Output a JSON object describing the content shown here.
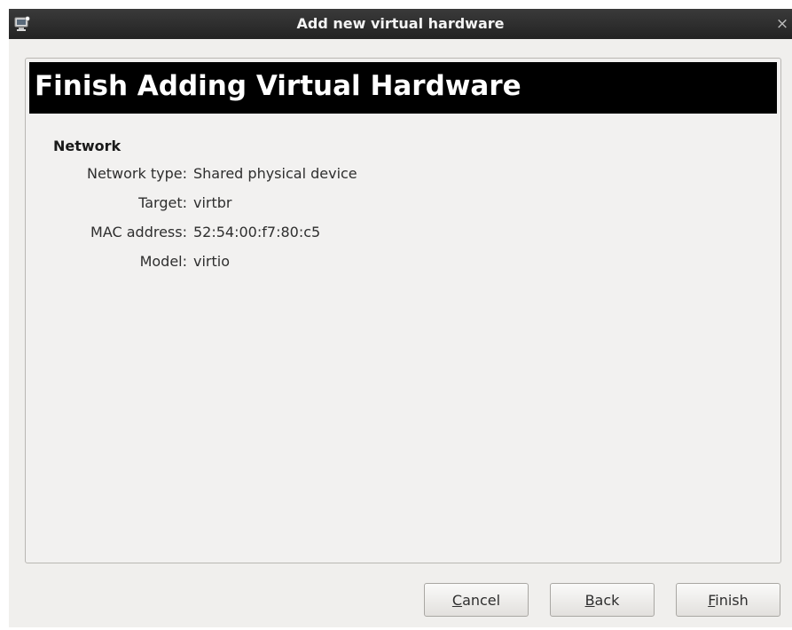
{
  "window": {
    "title": "Add new virtual hardware",
    "close_glyph": "×"
  },
  "banner": {
    "title": "Finish Adding Virtual Hardware"
  },
  "section": {
    "heading": "Network",
    "rows": [
      {
        "label": "Network type:",
        "value": "Shared physical device"
      },
      {
        "label": "Target:",
        "value": "virtbr"
      },
      {
        "label": "MAC address:",
        "value": "52:54:00:f7:80:c5"
      },
      {
        "label": "Model:",
        "value": "virtio"
      }
    ]
  },
  "buttons": {
    "cancel": {
      "mnemonic": "C",
      "rest": "ancel"
    },
    "back": {
      "mnemonic": "B",
      "rest": "ack"
    },
    "finish": {
      "mnemonic": "F",
      "rest": "inish"
    }
  },
  "colors": {
    "titlebar": "#2b2b2b",
    "window_bg": "#f0efed",
    "banner_bg": "#000000",
    "banner_text": "#ffffff"
  },
  "icons": {
    "app": "virtual-machine-icon",
    "close": "close-icon"
  }
}
